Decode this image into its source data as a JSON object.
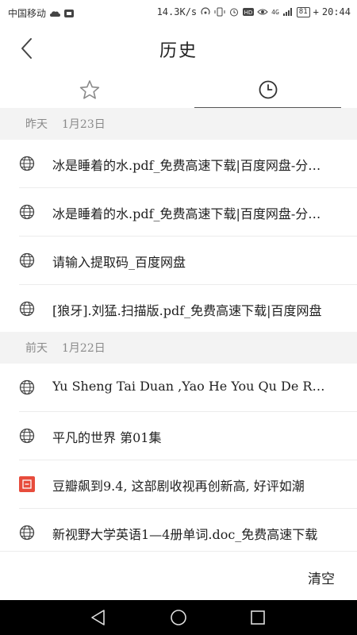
{
  "status_bar": {
    "carrier": "中国移动",
    "speed": "14.3K/s",
    "network": "4G",
    "battery": "81",
    "time": "20:44"
  },
  "header": {
    "title": "历史",
    "back_icon": "chevron-left-icon"
  },
  "tabs": [
    {
      "icon": "star-icon",
      "selected": false
    },
    {
      "icon": "clock-icon",
      "selected": true
    }
  ],
  "groups": [
    {
      "day": "昨天",
      "date": "1月23日",
      "items": [
        {
          "icon": "globe-icon",
          "text": "冰是睡着的水.pdf_免费高速下载|百度网盘-分享无限制"
        },
        {
          "icon": "globe-icon",
          "text": "冰是睡着的水.pdf_免费高速下载|百度网盘-分享无限制"
        },
        {
          "icon": "globe-icon",
          "text": "请输入提取码_百度网盘"
        },
        {
          "icon": "globe-icon",
          "text": "[狼牙].刘猛.扫描版.pdf_免费高速下载|百度网盘"
        }
      ]
    },
    {
      "day": "前天",
      "date": "1月22日",
      "items": [
        {
          "icon": "globe-icon",
          "text": "Yu Sheng Tai Duan ,Yao He You Qu De Ren Zai Yi Qi"
        },
        {
          "icon": "globe-icon",
          "text": "平凡的世界 第01集"
        },
        {
          "icon": "douban-icon",
          "text": "豆瓣飙到9.4, 这部剧收视再创新高, 好评如潮"
        },
        {
          "icon": "globe-icon",
          "text": "新视野大学英语1—4册单词.doc_免费高速下载"
        }
      ]
    }
  ],
  "footer": {
    "clear_label": "清空"
  },
  "colors": {
    "accent_douban": "#e74c3c",
    "group_bg": "#f3f3f3",
    "nav_bg": "#000000"
  }
}
